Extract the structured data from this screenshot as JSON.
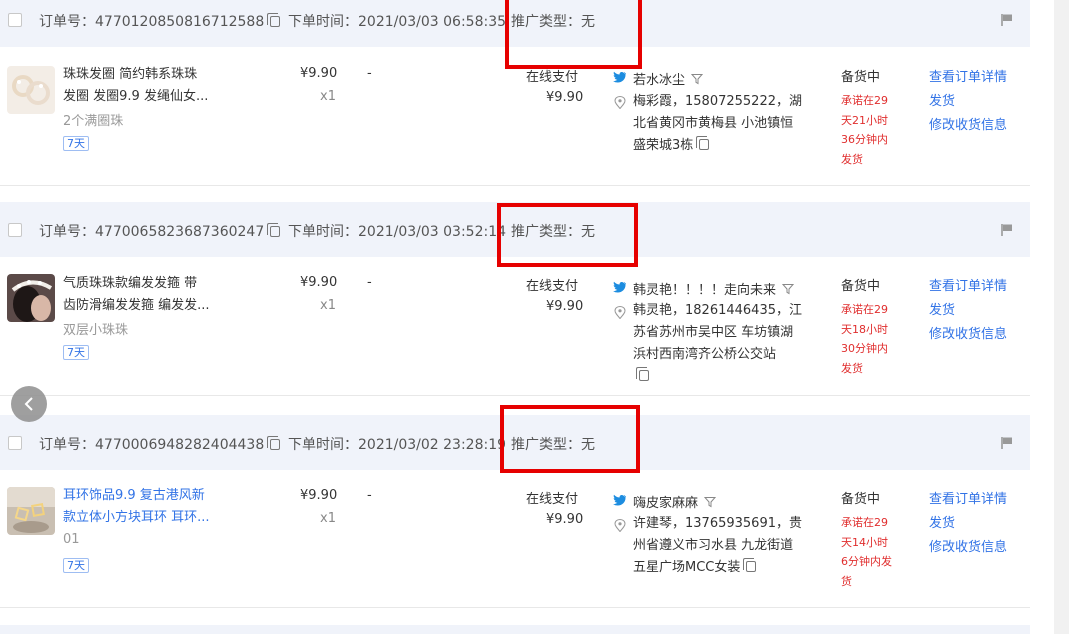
{
  "orders": [
    {
      "order_label": "订单号：",
      "order_no": "4770120850816712588",
      "time_label": "下单时间：",
      "order_time": "2021/03/03 06:58:35",
      "promo_label": "推广类型：",
      "promo_type": "无",
      "product": {
        "title_line1": "珠珠发圈 简约韩系珠珠",
        "title_line2": "发圈 发圈9.9 发绳仙女...",
        "sku": "2个满圈珠",
        "tag": "7天",
        "price": "¥9.90",
        "qty": "x1",
        "discount": "-"
      },
      "payment": {
        "method": "在线支付",
        "amount": "¥9.90"
      },
      "buyer": {
        "nickname": "若水冰尘",
        "addr_line1": "梅彩霞，15807255222，湖",
        "addr_line2": "北省黄冈市黄梅县 小池镇恒",
        "addr_line3": "盛荣城3栋"
      },
      "status": "备货中",
      "promise": [
        "承诺在29",
        "天21小时",
        "36分钟内",
        "发货"
      ],
      "actions": [
        "查看订单详情",
        "发货",
        "修改收货信息"
      ]
    },
    {
      "order_label": "订单号：",
      "order_no": "4770065823687360247",
      "time_label": "下单时间：",
      "order_time": "2021/03/03 03:52:14",
      "promo_label": "推广类型：",
      "promo_type": "无",
      "product": {
        "title_line1": "气质珠珠款编发发箍 带",
        "title_line2": "齿防滑编发发箍 编发发...",
        "sku": "双层小珠珠",
        "tag": "7天",
        "price": "¥9.90",
        "qty": "x1",
        "discount": "-"
      },
      "payment": {
        "method": "在线支付",
        "amount": "¥9.90"
      },
      "buyer": {
        "nickname": "韩灵艳！！！！走向未来",
        "addr_line1": "韩灵艳，18261446435，江",
        "addr_line2": "苏省苏州市吴中区 车坊镇湖",
        "addr_line3": "浜村西南湾齐公桥公交站"
      },
      "status": "备货中",
      "promise": [
        "承诺在29",
        "天18小时",
        "30分钟内",
        "发货"
      ],
      "actions": [
        "查看订单详情",
        "发货",
        "修改收货信息"
      ]
    },
    {
      "order_label": "订单号：",
      "order_no": "4770006948282404438",
      "time_label": "下单时间：",
      "order_time": "2021/03/02 23:28:19",
      "promo_label": "推广类型：",
      "promo_type": "无",
      "product": {
        "title_line1": "耳环饰品9.9 复古港风新",
        "title_line2": "款立体小方块耳环 耳环...",
        "sku": "01",
        "tag": "7天",
        "price": "¥9.90",
        "qty": "x1",
        "discount": "-"
      },
      "payment": {
        "method": "在线支付",
        "amount": "¥9.90"
      },
      "buyer": {
        "nickname": "嗨皮家麻麻",
        "addr_line1": "许建琴，13765935691，贵",
        "addr_line2": "州省遵义市习水县 九龙街道",
        "addr_line3": "五星广场MCC女装"
      },
      "status": "备货中",
      "promise": [
        "承诺在29",
        "天14小时",
        "6分钟内发",
        "货"
      ],
      "actions": [
        "查看订单详情",
        "发货",
        "修改收货信息"
      ]
    }
  ],
  "colors": {
    "link": "#3273e6",
    "highlight_box": "#e60000",
    "promise_text": "#e02e2e",
    "header_bg": "#f0f3fa"
  }
}
